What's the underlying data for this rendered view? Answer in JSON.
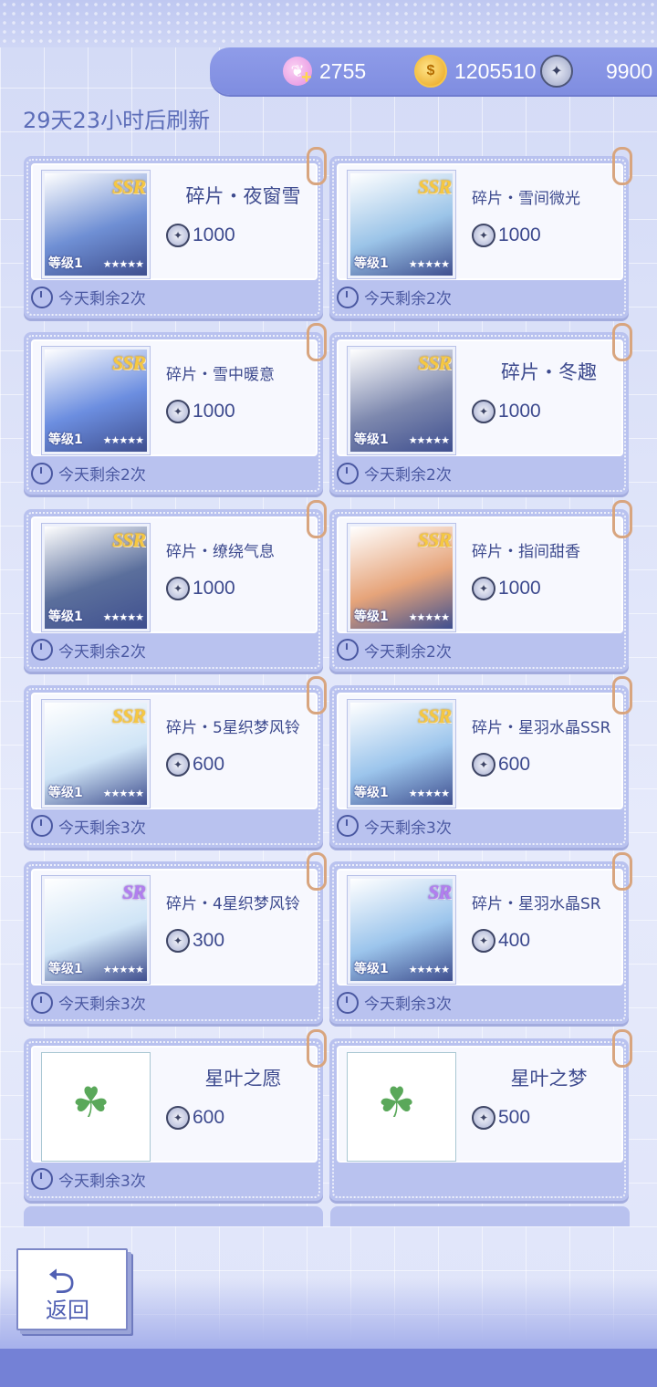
{
  "currency": {
    "swan_icon": "swan-icon",
    "swan_value": "2755",
    "coin_icon": "coin-icon",
    "coin_value": "1205510",
    "compass_icon": "compass-icon",
    "compass_value": "9900"
  },
  "refresh_text": "29天23小时后刷新",
  "level_label": "等级1",
  "remain_prefix": "今天剩余",
  "items": [
    {
      "name": "碎片・夜窗雪",
      "price": "1000",
      "grade": "SSR",
      "remain": "今天剩余2次",
      "thumb_color": "#6f8fd4"
    },
    {
      "name": "碎片・雪间微光",
      "price": "1000",
      "grade": "SSR",
      "remain": "今天剩余2次",
      "thumb_color": "#9bc4e8"
    },
    {
      "name": "碎片・雪中暖意",
      "price": "1000",
      "grade": "SSR",
      "remain": "今天剩余2次",
      "thumb_color": "#6c8ee0"
    },
    {
      "name": "碎片・冬趣",
      "price": "1000",
      "grade": "SSR",
      "remain": "今天剩余2次",
      "thumb_color": "#7d88ae"
    },
    {
      "name": "碎片・缭绕气息",
      "price": "1000",
      "grade": "SSR",
      "remain": "今天剩余2次",
      "thumb_color": "#5b6f9c"
    },
    {
      "name": "碎片・指间甜香",
      "price": "1000",
      "grade": "SSR",
      "remain": "今天剩余2次",
      "thumb_color": "#e6a47a"
    },
    {
      "name": "碎片・5星织梦风铃",
      "price": "600",
      "grade": "SSR",
      "remain": "今天剩余3次",
      "thumb_color": "#cfe4f6"
    },
    {
      "name": "碎片・星羽水晶SSR",
      "price": "600",
      "grade": "SSR",
      "remain": "今天剩余3次",
      "thumb_color": "#9cc5ec"
    },
    {
      "name": "碎片・4星织梦风铃",
      "price": "300",
      "grade": "SR",
      "remain": "今天剩余3次",
      "thumb_color": "#cfe4f6"
    },
    {
      "name": "碎片・星羽水晶SR",
      "price": "400",
      "grade": "SR",
      "remain": "今天剩余3次",
      "thumb_color": "#9cc5ec"
    },
    {
      "name": "星叶之愿",
      "price": "600",
      "grade": "",
      "remain": "今天剩余3次",
      "thumb_color": "#ffffff"
    },
    {
      "name": "星叶之梦",
      "price": "500",
      "grade": "",
      "remain": "",
      "thumb_color": "#ffffff"
    }
  ],
  "back_label": "返回"
}
